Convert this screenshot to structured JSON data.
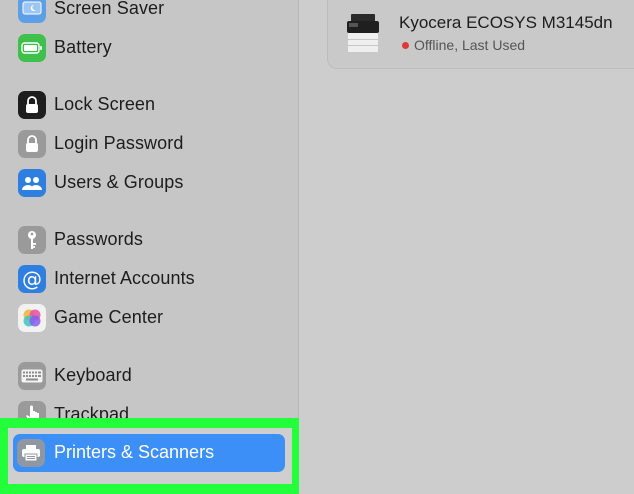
{
  "sidebar": {
    "items": [
      {
        "label": "Screen Saver",
        "icon": "screen-saver-icon"
      },
      {
        "label": "Battery",
        "icon": "battery-icon"
      },
      {
        "label": "Lock Screen",
        "icon": "lock-screen-icon"
      },
      {
        "label": "Login Password",
        "icon": "padlock-icon"
      },
      {
        "label": "Users & Groups",
        "icon": "users-icon"
      },
      {
        "label": "Passwords",
        "icon": "key-icon"
      },
      {
        "label": "Internet Accounts",
        "icon": "at-sign-icon"
      },
      {
        "label": "Game Center",
        "icon": "game-center-icon"
      },
      {
        "label": "Keyboard",
        "icon": "keyboard-icon"
      },
      {
        "label": "Trackpad",
        "icon": "trackpad-icon"
      },
      {
        "label": "Printers & Scanners",
        "icon": "printer-icon"
      }
    ],
    "selected": "Printers & Scanners"
  },
  "printer": {
    "name": "Kyocera ECOSYS M3145dn",
    "status": "Offline, Last Used",
    "status_color": "#e0393a",
    "icon": "printer-device-icon"
  },
  "colors": {
    "accent": "#3c8ff6",
    "highlight": "#23ff3a"
  }
}
